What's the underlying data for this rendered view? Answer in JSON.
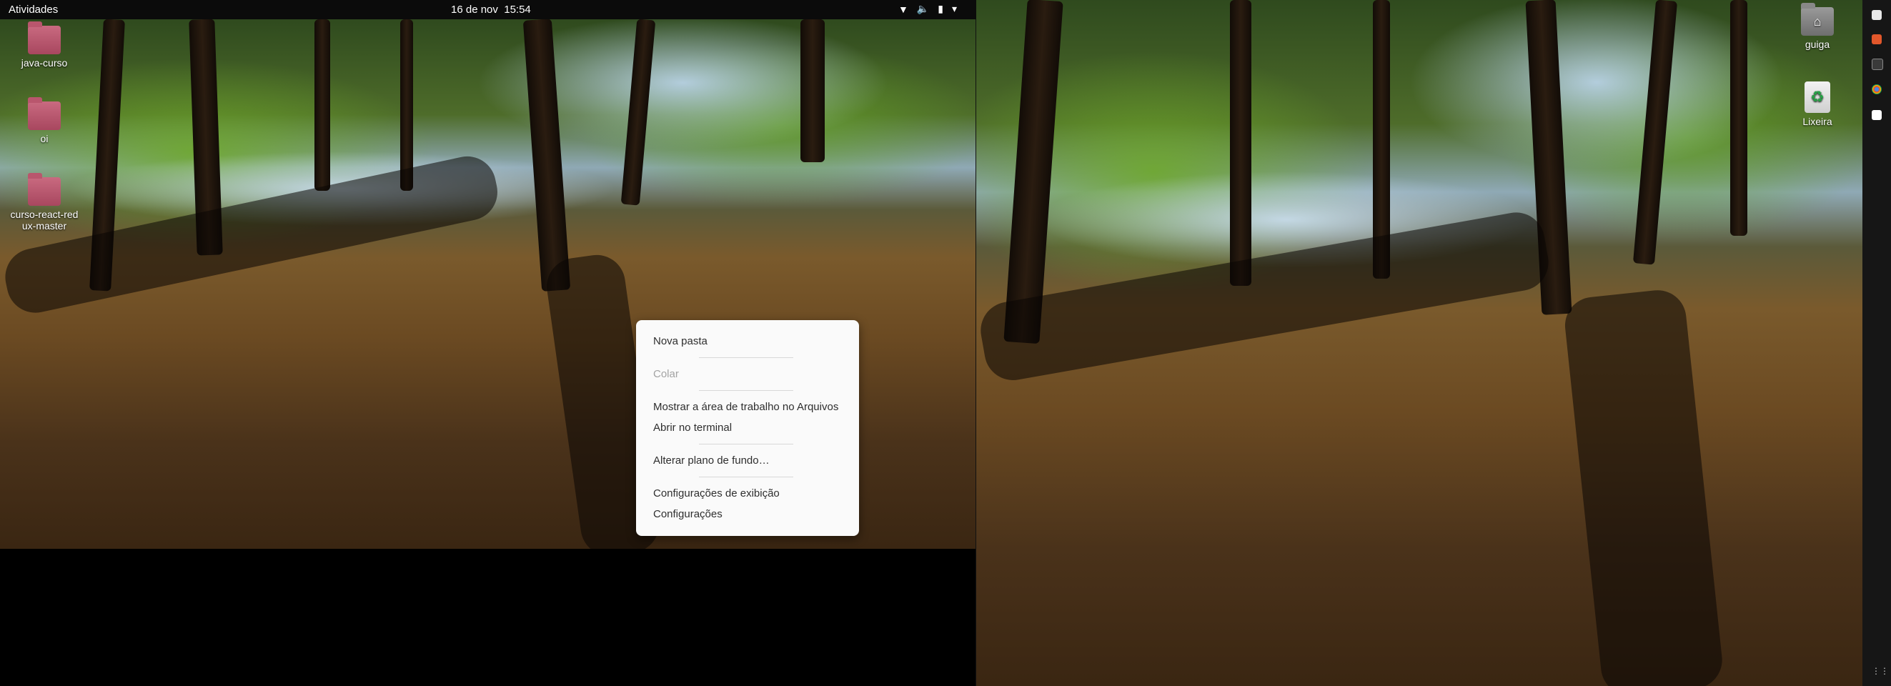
{
  "topbar": {
    "activities": "Atividades",
    "date": "16 de nov",
    "time": "15:54"
  },
  "desktop_left": {
    "icons": [
      {
        "label": "java-curso",
        "icon": "folder-icon"
      },
      {
        "label": "oi",
        "icon": "folder-icon"
      },
      {
        "label": "curso-react-redux-master",
        "icon": "folder-icon"
      }
    ]
  },
  "desktop_right": {
    "icons": [
      {
        "label": "guiga",
        "icon": "home-folder-icon"
      },
      {
        "label": "Lixeira",
        "icon": "trash-icon"
      }
    ]
  },
  "context_menu": {
    "new_folder": "Nova pasta",
    "paste": "Colar",
    "show_in_files": "Mostrar a área de trabalho no Arquivos",
    "open_terminal": "Abrir no terminal",
    "change_background": "Alterar plano de fundo…",
    "display_settings": "Configurações de exibição",
    "settings": "Configurações"
  },
  "colors": {
    "folder": "#b9566d",
    "menu_bg": "#fafafa",
    "topbar_bg": "#0b0b0b"
  }
}
